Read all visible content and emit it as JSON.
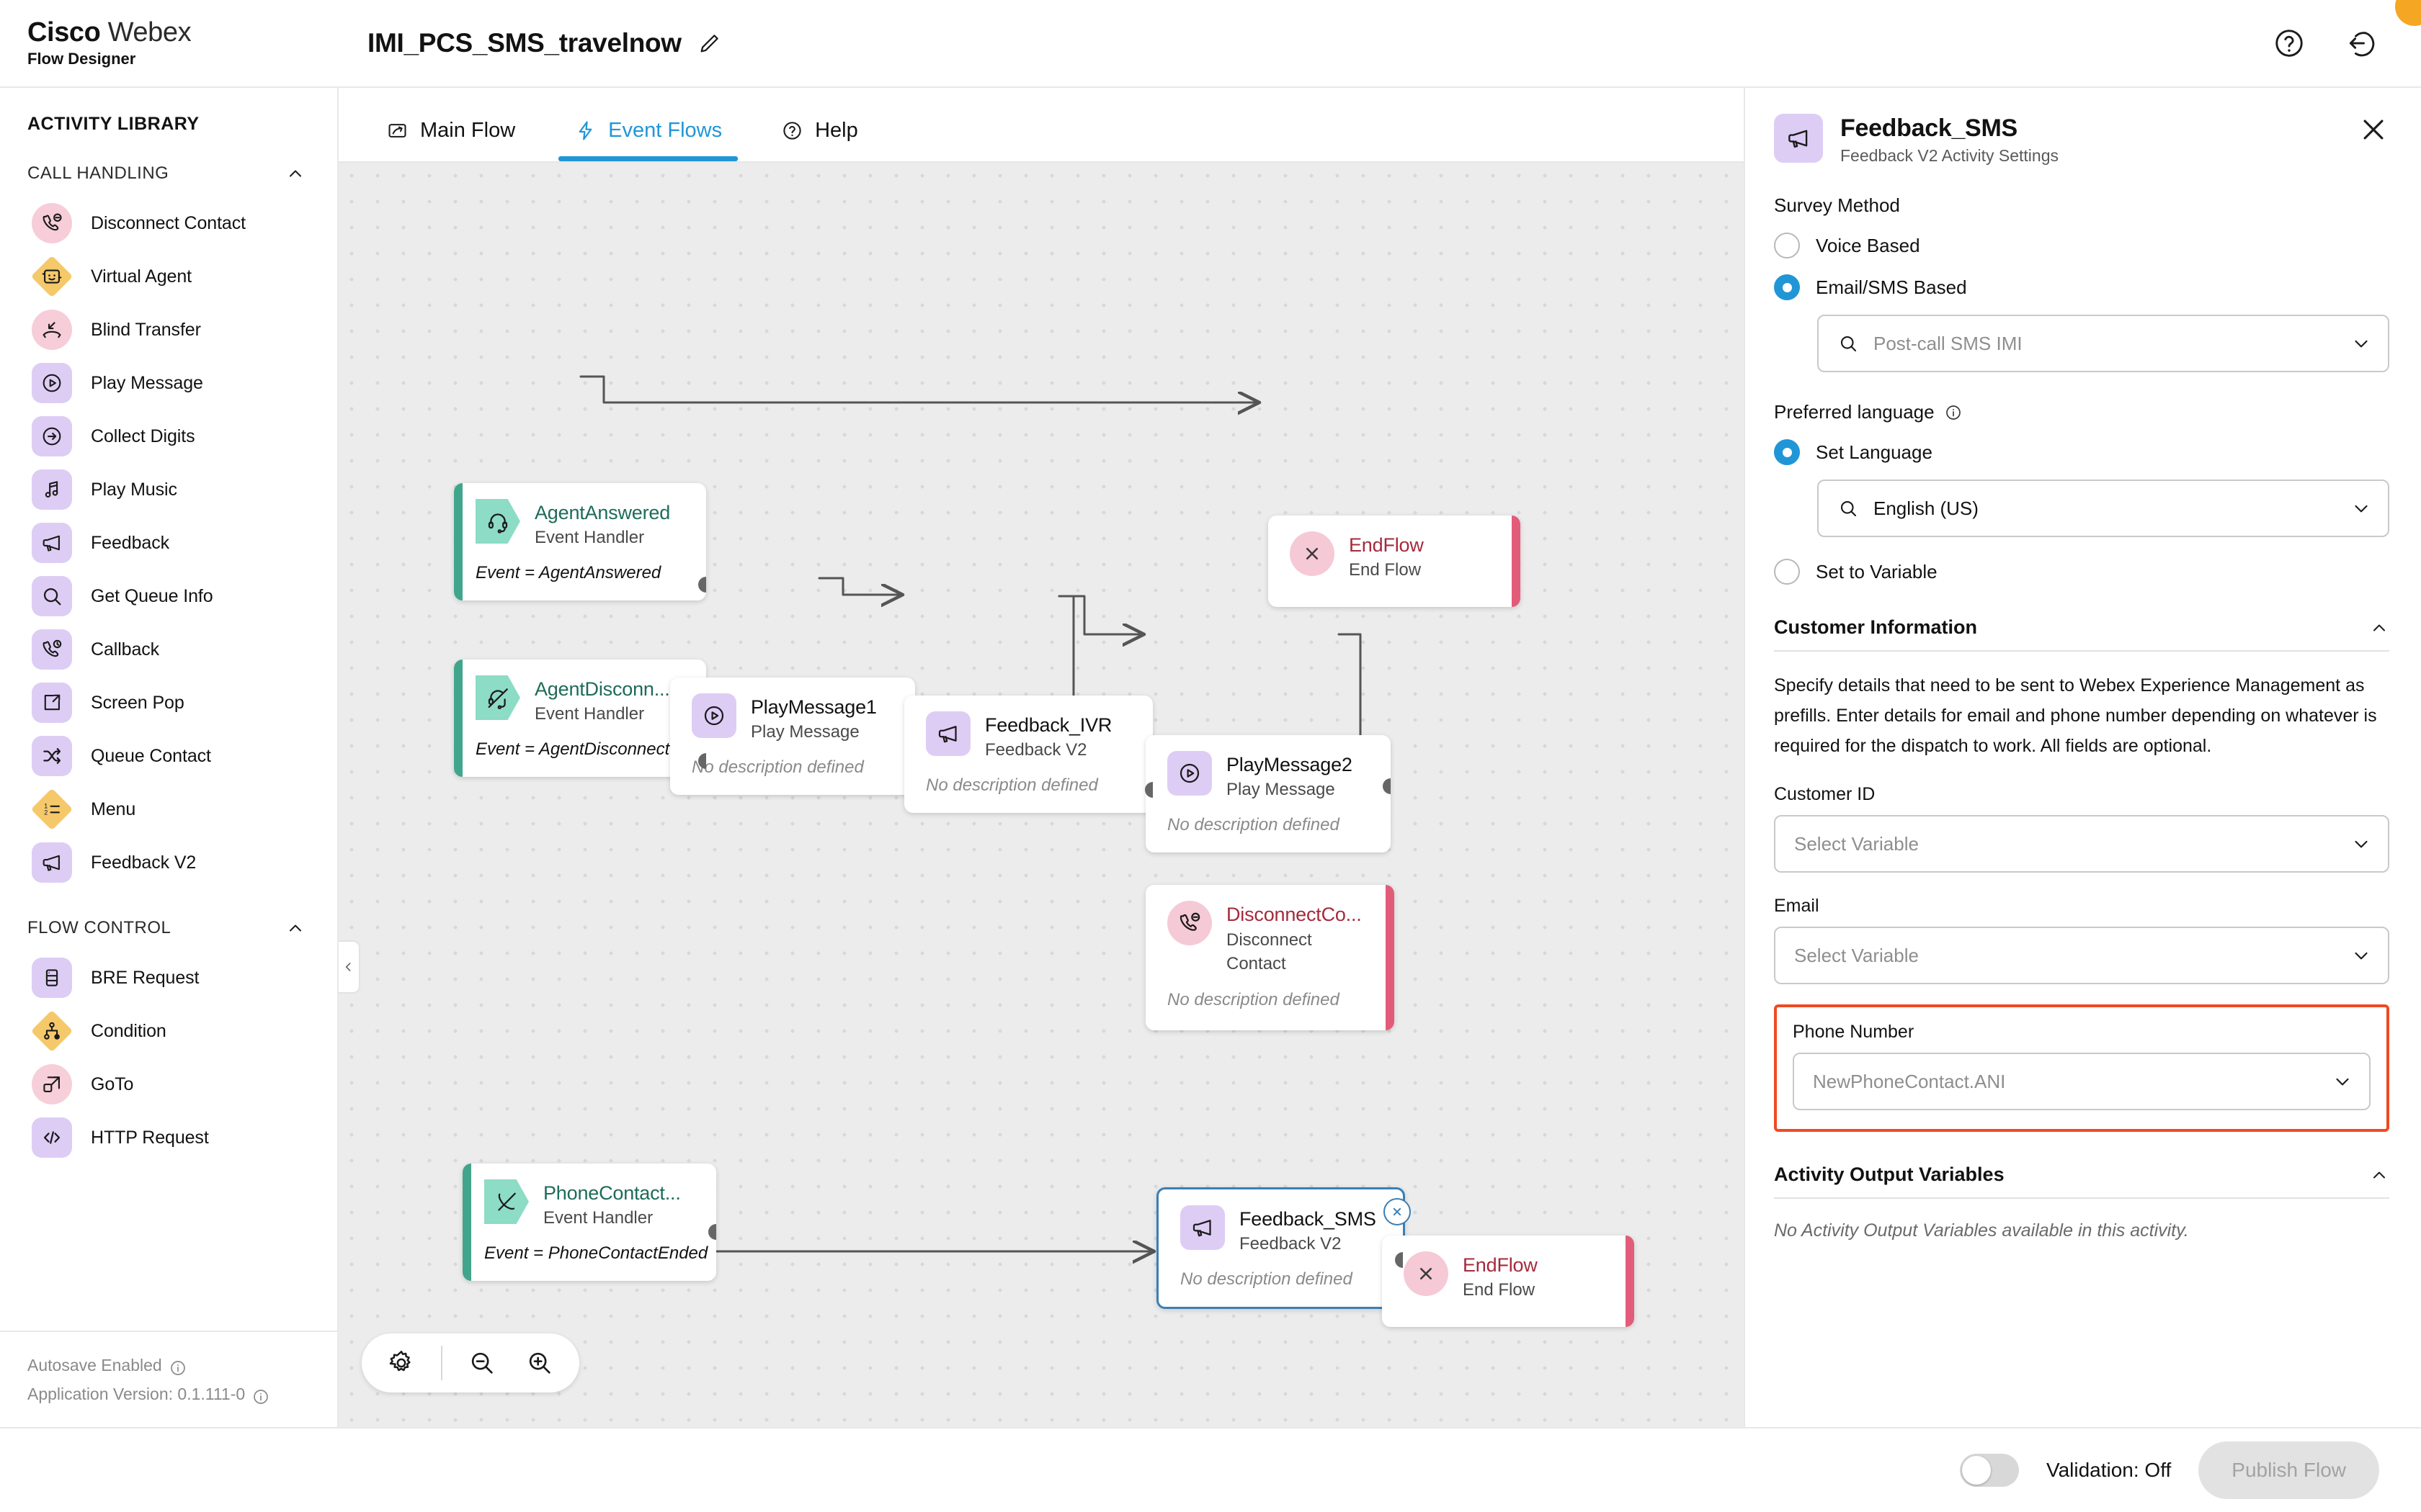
{
  "header": {
    "brand_bold": "Cisco",
    "brand_light": "Webex",
    "brand_product": "Flow Designer",
    "flow_name": "IMI_PCS_SMS_travelnow",
    "help_icon": "help-circle-icon",
    "logout_icon": "logout-icon",
    "edit_icon": "pencil-icon"
  },
  "sidebar": {
    "title": "ACTIVITY LIBRARY",
    "groups": [
      {
        "label": "CALL HANDLING",
        "items": [
          {
            "label": "Disconnect Contact",
            "icon": "phone-disconnect-icon",
            "shape": "circle-pink"
          },
          {
            "label": "Virtual Agent",
            "icon": "chat-bot-icon",
            "shape": "diamond-yellow"
          },
          {
            "label": "Blind Transfer",
            "icon": "phone-transfer-icon",
            "shape": "circle-pink"
          },
          {
            "label": "Play Message",
            "icon": "play-circle-icon",
            "shape": "round-purple"
          },
          {
            "label": "Collect Digits",
            "icon": "arrow-right-circle-icon",
            "shape": "round-purple"
          },
          {
            "label": "Play Music",
            "icon": "music-note-icon",
            "shape": "round-purple"
          },
          {
            "label": "Feedback",
            "icon": "megaphone-icon",
            "shape": "round-purple"
          },
          {
            "label": "Get Queue Info",
            "icon": "search-icon",
            "shape": "round-purple"
          },
          {
            "label": "Callback",
            "icon": "phone-clock-icon",
            "shape": "round-purple"
          },
          {
            "label": "Screen Pop",
            "icon": "external-link-icon",
            "shape": "round-purple"
          },
          {
            "label": "Queue Contact",
            "icon": "shuffle-icon",
            "shape": "round-purple"
          },
          {
            "label": "Menu",
            "icon": "numbered-list-icon",
            "shape": "diamond-yellow"
          },
          {
            "label": "Feedback V2",
            "icon": "megaphone-icon",
            "shape": "round-purple"
          }
        ]
      },
      {
        "label": "FLOW CONTROL",
        "items": [
          {
            "label": "BRE Request",
            "icon": "database-icon",
            "shape": "round-purple"
          },
          {
            "label": "Condition",
            "icon": "branch-icon",
            "shape": "diamond-yellow"
          },
          {
            "label": "GoTo",
            "icon": "goto-icon",
            "shape": "circle-pink"
          },
          {
            "label": "HTTP Request",
            "icon": "code-icon",
            "shape": "round-purple"
          }
        ]
      }
    ],
    "footer": {
      "autosave": "Autosave Enabled",
      "version": "Application Version: 0.1.111-0",
      "info_icon": "info-icon"
    }
  },
  "canvas": {
    "tabs": [
      {
        "label": "Main Flow",
        "icon": "flow-icon",
        "active": false
      },
      {
        "label": "Event Flows",
        "icon": "lightning-icon",
        "active": true
      },
      {
        "label": "Help",
        "icon": "help-circle-icon",
        "active": false
      }
    ],
    "nodes": [
      {
        "title": "AgentAnswered",
        "subtitle": "Event Handler",
        "desc": "Event = AgentAnswered",
        "kind": "event-handler",
        "icon": "headset-icon"
      },
      {
        "title": "EndFlow",
        "subtitle": "End Flow",
        "desc": "",
        "kind": "end-flow",
        "icon": "close-circle-icon"
      },
      {
        "title": "AgentDisconn...",
        "subtitle": "Event Handler",
        "desc": "Event = AgentDisconnected",
        "kind": "event-handler",
        "icon": "headset-off-icon"
      },
      {
        "title": "PlayMessage1",
        "subtitle": "Play Message",
        "desc": "No description defined",
        "kind": "activity",
        "icon": "play-circle-icon"
      },
      {
        "title": "Feedback_IVR",
        "subtitle": "Feedback V2",
        "desc": "No description defined",
        "kind": "activity",
        "icon": "megaphone-icon"
      },
      {
        "title": "PlayMessage2",
        "subtitle": "Play Message",
        "desc": "No description defined",
        "kind": "activity",
        "icon": "play-circle-icon"
      },
      {
        "title": "DisconnectCo...",
        "subtitle": "Disconnect Contact",
        "desc": "No description defined",
        "kind": "disconnect",
        "icon": "phone-disconnect-icon"
      },
      {
        "title": "PhoneContact...",
        "subtitle": "Event Handler",
        "desc": "Event = PhoneContactEnded",
        "kind": "event-handler",
        "icon": "phone-end-icon"
      },
      {
        "title": "Feedback_SMS",
        "subtitle": "Feedback V2",
        "desc": "No description defined",
        "kind": "activity-selected",
        "icon": "megaphone-icon"
      },
      {
        "title": "EndFlow",
        "subtitle": "End Flow",
        "desc": "",
        "kind": "end-flow",
        "icon": "close-circle-icon"
      }
    ],
    "controls": {
      "settings_icon": "gear-icon",
      "zoom_out_icon": "zoom-out-icon",
      "zoom_in_icon": "zoom-in-icon"
    }
  },
  "panel": {
    "title": "Feedback_SMS",
    "subtitle": "Feedback V2 Activity Settings",
    "icon": "megaphone-icon",
    "close_icon": "close-icon",
    "survey_method_label": "Survey Method",
    "survey_options": [
      {
        "label": "Voice Based",
        "selected": false
      },
      {
        "label": "Email/SMS Based",
        "selected": true
      }
    ],
    "survey_select_value": "Post-call SMS IMI",
    "preferred_language_label": "Preferred language",
    "language_options": [
      {
        "label": "Set Language",
        "selected": true
      },
      {
        "label": "Set to Variable",
        "selected": false
      }
    ],
    "language_select_value": "English (US)",
    "customer_information": {
      "title": "Customer Information",
      "description": "Specify details that need to be sent to Webex Experience Management as prefills. Enter details for email and phone number depending on whatever is required for the dispatch to work. All fields are optional.",
      "customer_id_label": "Customer ID",
      "customer_id_value": "Select Variable",
      "email_label": "Email",
      "email_value": "Select Variable",
      "phone_label": "Phone Number",
      "phone_value": "NewPhoneContact.ANI",
      "highlight_color": "#f04a23"
    },
    "activity_output": {
      "title": "Activity Output Variables",
      "empty_note": "No Activity Output Variables available in this activity."
    }
  },
  "bottom": {
    "validation_label": "Validation: Off",
    "validation_on": false,
    "publish_label": "Publish Flow"
  }
}
